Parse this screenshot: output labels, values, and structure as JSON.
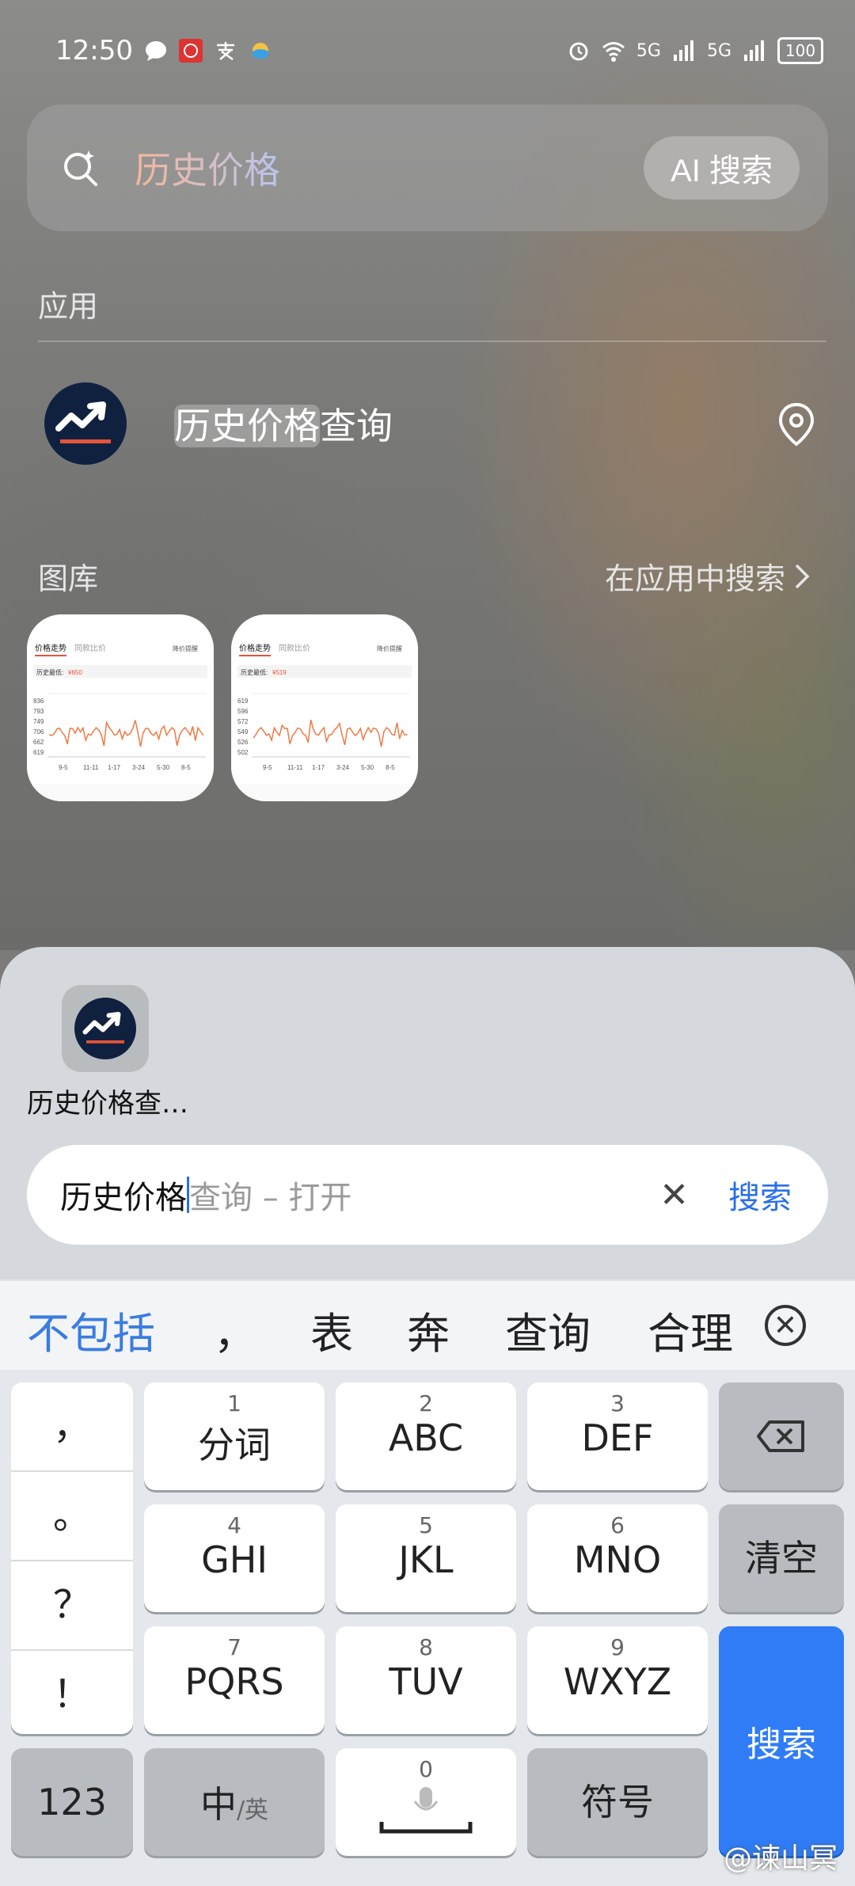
{
  "status_bar": {
    "time": "12:50",
    "battery": "100",
    "signal_label_1": "5G",
    "signal_label_2": "5G"
  },
  "search": {
    "query": "历史价格",
    "ai_button": "AI 搜索"
  },
  "sections": {
    "apps_label": "应用",
    "gallery_label": "图库",
    "gallery_more": "在应用中搜索"
  },
  "app_result": {
    "name_highlight": "历史价格",
    "name_rest": "查询"
  },
  "thumbs": [
    {
      "tab1": "价格走势",
      "tab2": "同款比价",
      "tab3": "降价提醒",
      "low_label": "历史最低:",
      "low_value": "¥650",
      "y1": "836",
      "y2": "793",
      "y3": "749",
      "y4": "706",
      "y5": "662",
      "y6": "619",
      "xl": [
        "9-5",
        "11-11",
        "1-17",
        "3-24",
        "5-30",
        "8-5"
      ]
    },
    {
      "tab1": "价格走势",
      "tab2": "同款比价",
      "tab3": "降价提醒",
      "low_label": "历史最低:",
      "low_value": "¥519",
      "y1": "619",
      "y2": "596",
      "y3": "572",
      "y4": "549",
      "y5": "526",
      "y6": "502",
      "xl": [
        "9-5",
        "11-11",
        "1-17",
        "3-24",
        "5-30",
        "8-5"
      ]
    }
  ],
  "sheet": {
    "app_label": "历史价格查…",
    "typed": "历史价格",
    "hint": "查询 – 打开",
    "clear": "✕",
    "search_btn": "搜索"
  },
  "candidates": [
    "不包括",
    "，",
    "表",
    "奔",
    "查询",
    "合理"
  ],
  "keyboard": {
    "punct": [
      "，",
      "。",
      "？",
      "！"
    ],
    "rows": [
      [
        {
          "num": "1",
          "label": "分词"
        },
        {
          "num": "2",
          "label": "ABC"
        },
        {
          "num": "3",
          "label": "DEF"
        }
      ],
      [
        {
          "num": "4",
          "label": "GHI"
        },
        {
          "num": "5",
          "label": "JKL"
        },
        {
          "num": "6",
          "label": "MNO"
        }
      ],
      [
        {
          "num": "7",
          "label": "PQRS"
        },
        {
          "num": "8",
          "label": "TUV"
        },
        {
          "num": "9",
          "label": "WXYZ"
        }
      ]
    ],
    "clear_all": "清空",
    "search": "搜索",
    "k123": "123",
    "zh": "中",
    "en": "/英",
    "space_num": "0",
    "symbols": "符号"
  },
  "watermark": "@谏山冥"
}
